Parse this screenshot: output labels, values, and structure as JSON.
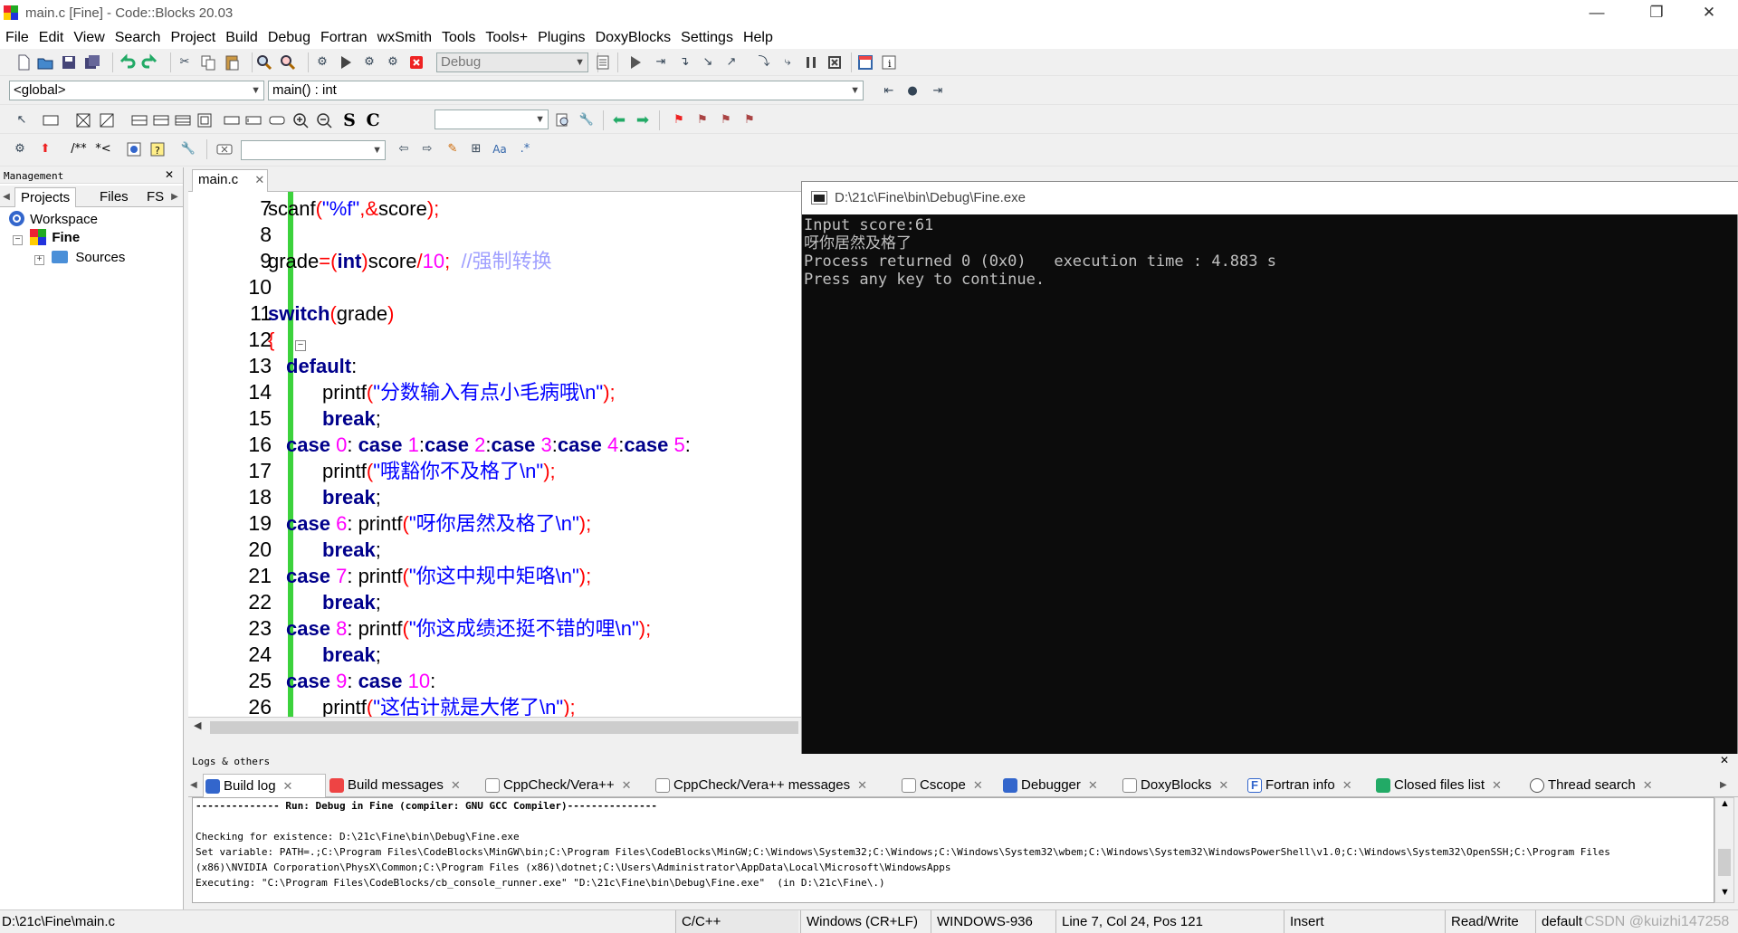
{
  "window": {
    "title": "main.c [Fine] - Code::Blocks 20.03",
    "minimize": "—",
    "restore": "❐",
    "close": "✕"
  },
  "menu": [
    "File",
    "Edit",
    "View",
    "Search",
    "Project",
    "Build",
    "Debug",
    "Fortran",
    "wxSmith",
    "Tools",
    "Tools+",
    "Plugins",
    "DoxyBlocks",
    "Settings",
    "Help"
  ],
  "toolbar": {
    "build_target": "Debug",
    "scope": "<global>",
    "function": "main() : int",
    "font_s": "S",
    "font_c": "C",
    "comment_block": "/**",
    "comment_line": "*<"
  },
  "management": {
    "title": "Management",
    "tabs": [
      "Projects",
      "Files",
      "FS"
    ],
    "tree": {
      "workspace": "Workspace",
      "project": "Fine",
      "folder": "Sources"
    }
  },
  "editor": {
    "tab": "main.c",
    "close": "✕",
    "lines": [
      {
        "n": "7"
      },
      {
        "n": "8"
      },
      {
        "n": "9"
      },
      {
        "n": "10"
      },
      {
        "n": "11"
      },
      {
        "n": "12"
      },
      {
        "n": "13"
      },
      {
        "n": "14"
      },
      {
        "n": "15"
      },
      {
        "n": "16"
      },
      {
        "n": "17"
      },
      {
        "n": "18"
      },
      {
        "n": "19"
      },
      {
        "n": "20"
      },
      {
        "n": "21"
      },
      {
        "n": "22"
      },
      {
        "n": "23"
      },
      {
        "n": "24"
      },
      {
        "n": "25"
      },
      {
        "n": "26"
      }
    ],
    "code": {
      "l7": [
        "scanf",
        "(",
        "\"%f\"",
        ",&",
        "score",
        ");"
      ],
      "l9": [
        "grade",
        "=(",
        "int",
        ")",
        "score",
        "/",
        "10",
        ";",
        "  //强制转换"
      ],
      "l11": [
        "switch",
        "(",
        "grade",
        ")"
      ],
      "l12": [
        "{"
      ],
      "l13": [
        "default",
        ":"
      ],
      "l14": [
        "printf",
        "(",
        "\"分数输入有点小毛病哦\\n\"",
        ");"
      ],
      "l15": [
        "break",
        ";"
      ],
      "l16": [
        "case",
        " ",
        "0",
        ": ",
        "case",
        " ",
        "1",
        ":",
        "case",
        " ",
        "2",
        ":",
        "case",
        " ",
        "3",
        ":",
        "case",
        " ",
        "4",
        ":",
        "case",
        " ",
        "5",
        ":"
      ],
      "l17": [
        "printf",
        "(",
        "\"哦豁你不及格了\\n\"",
        ");"
      ],
      "l18": [
        "break",
        ";"
      ],
      "l19": [
        "case",
        " ",
        "6",
        ": ",
        "printf",
        "(",
        "\"呀你居然及格了\\n\"",
        ");"
      ],
      "l20": [
        "break",
        ";"
      ],
      "l21": [
        "case",
        " ",
        "7",
        ": ",
        "printf",
        "(",
        "\"你这中规中矩咯\\n\"",
        ");"
      ],
      "l22": [
        "break",
        ";"
      ],
      "l23": [
        "case",
        " ",
        "8",
        ": ",
        "printf",
        "(",
        "\"你这成绩还挺不错的哩\\n\"",
        ");"
      ],
      "l24": [
        "break",
        ";"
      ],
      "l25": [
        "case",
        " ",
        "9",
        ": ",
        "case",
        " ",
        "10",
        ":"
      ],
      "l26": [
        "printf",
        "(",
        "\"这估计就是大佬了\\n\"",
        ");"
      ]
    }
  },
  "console": {
    "title": "D:\\21c\\Fine\\bin\\Debug\\Fine.exe",
    "lines": [
      "Input score:61",
      "呀你居然及格了",
      "",
      "Process returned 0 (0x0)   execution time : 4.883 s",
      "Press any key to continue."
    ]
  },
  "logs": {
    "title": "Logs & others",
    "tabs": [
      "Build log",
      "Build messages",
      "CppCheck/Vera++",
      "CppCheck/Vera++ messages",
      "Cscope",
      "Debugger",
      "DoxyBlocks",
      "Fortran info",
      "Closed files list",
      "Thread search"
    ],
    "body": [
      "-------------- Run: Debug in Fine (compiler: GNU GCC Compiler)---------------",
      "",
      "Checking for existence: D:\\21c\\Fine\\bin\\Debug\\Fine.exe",
      "Set variable: PATH=.;C:\\Program Files\\CodeBlocks\\MinGW\\bin;C:\\Program Files\\CodeBlocks\\MinGW;C:\\Windows\\System32;C:\\Windows;C:\\Windows\\System32\\wbem;C:\\Windows\\System32\\WindowsPowerShell\\v1.0;C:\\Windows\\System32\\OpenSSH;C:\\Program Files",
      "(x86)\\NVIDIA Corporation\\PhysX\\Common;C:\\Program Files (x86)\\dotnet;C:\\Users\\Administrator\\AppData\\Local\\Microsoft\\WindowsApps",
      "Executing: \"C:\\Program Files\\CodeBlocks/cb_console_runner.exe\" \"D:\\21c\\Fine\\bin\\Debug\\Fine.exe\"  (in D:\\21c\\Fine\\.)"
    ]
  },
  "status": {
    "file": "D:\\21c\\Fine\\main.c",
    "lang": "C/C++",
    "eol": "Windows (CR+LF)",
    "encoding": "WINDOWS-936",
    "position": "Line 7, Col 24, Pos 121",
    "mode": "Insert",
    "access": "Read/Write",
    "profile": "default",
    "watermark": "CSDN @kuizhi147258"
  },
  "colors": {
    "gutter_change": "#3cd23c",
    "keyword": "#00008b",
    "string": "#0000ff",
    "number": "#ff00ff",
    "operator": "#ff0000",
    "comment": "#a0a0ff"
  }
}
